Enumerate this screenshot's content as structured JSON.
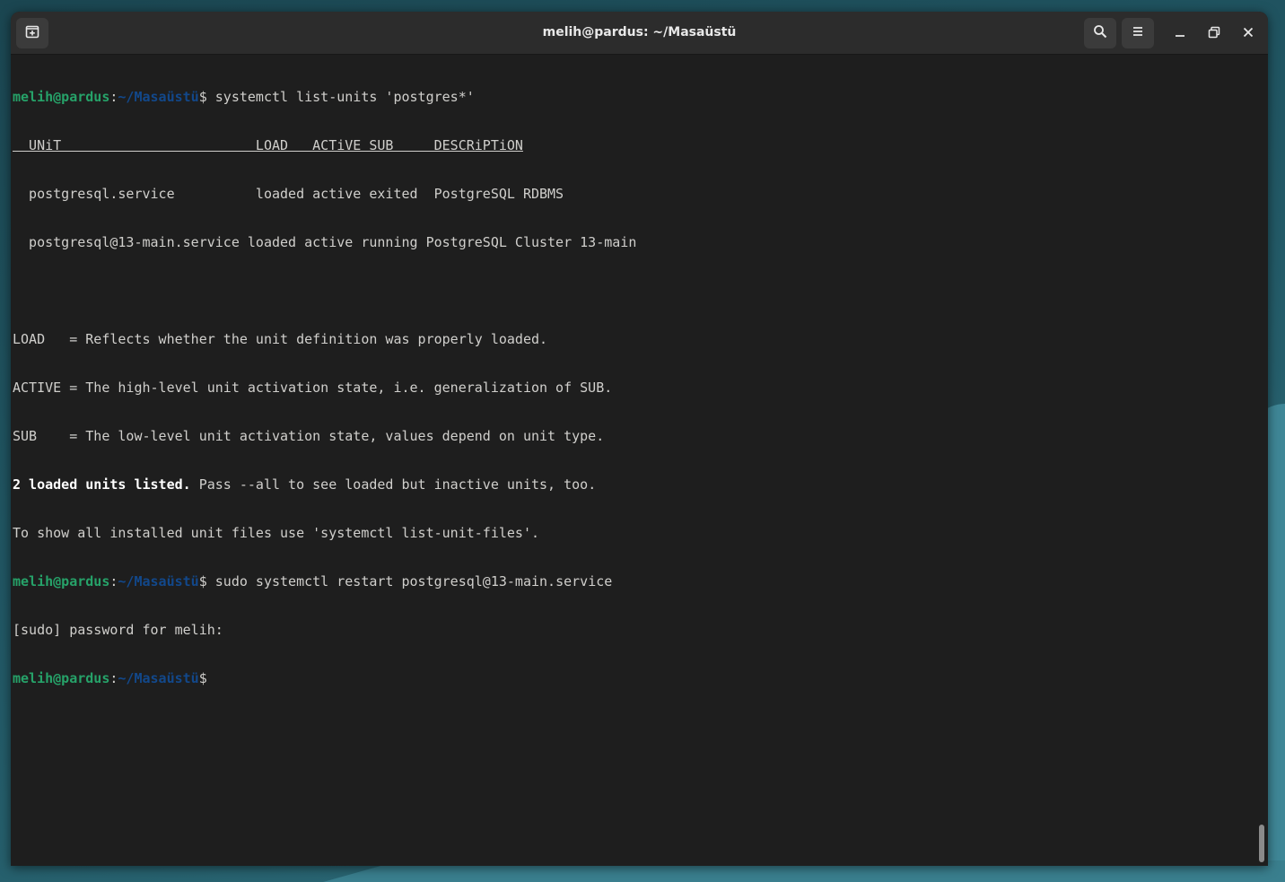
{
  "window": {
    "title": "melih@pardus: ~/Masaüstü"
  },
  "titlebar": {
    "new_tab_icon": "new-tab-icon",
    "search_icon": "search-icon",
    "menu_icon": "hamburger-menu-icon",
    "minimize_icon": "minimize-icon",
    "maximize_icon": "maximize-icon",
    "close_icon": "close-icon"
  },
  "prompt": {
    "user_host": "melih@pardus",
    "colon": ":",
    "path": "~/Masaüstü",
    "dollar": "$"
  },
  "terminal": {
    "cmd1": " systemctl list-units 'postgres*'",
    "header": "  UNiT                        LOAD   ACTiVE SUB     DESCRiPTiON",
    "row1": "  postgresql.service          loaded active exited  PostgreSQL RDBMS",
    "row2": "  postgresql@13-main.service loaded active running PostgreSQL Cluster 13-main",
    "legend_load": "LOAD   = Reflects whether the unit definition was properly loaded.",
    "legend_active": "ACTIVE = The high-level unit activation state, i.e. generalization of SUB.",
    "legend_sub": "SUB    = The low-level unit activation state, values depend on unit type.",
    "summary_bold": "2 loaded units listed.",
    "summary_rest": " Pass --all to see loaded but inactive units, too.",
    "hint": "To show all installed unit files use 'systemctl list-unit-files'.",
    "cmd2": " sudo systemctl restart postgresql@13-main.service",
    "sudo_prompt": "[sudo] password for melih:"
  },
  "colors": {
    "prompt_user": "#26a269",
    "prompt_path": "#12488b",
    "terminal_bg": "#1e1e1e",
    "titlebar_bg": "#2c2c2c"
  }
}
